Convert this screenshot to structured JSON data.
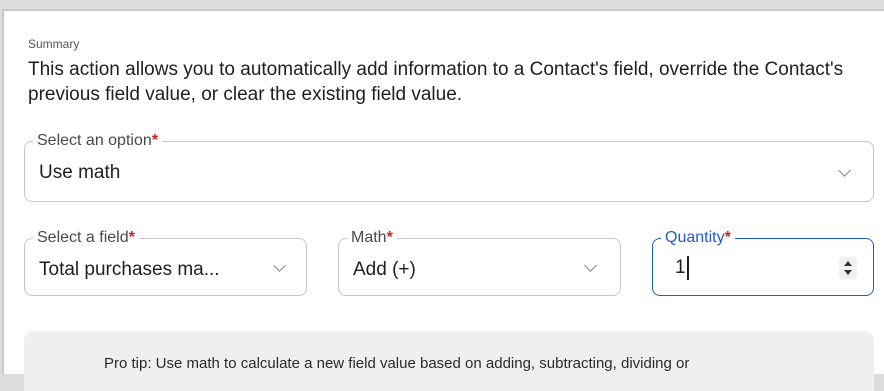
{
  "summary": {
    "label": "Summary",
    "text": "This action allows you to automatically add information to a Contact's field, override the Contact's previous field value, or clear the existing field value."
  },
  "option_select": {
    "label": "Select an option",
    "required_mark": "*",
    "value": "Use math",
    "icon": "chevron-down-icon"
  },
  "field_select": {
    "label": "Select a field",
    "required_mark": "*",
    "value": "Total purchases ma...",
    "icon": "chevron-down-icon"
  },
  "math_select": {
    "label": "Math",
    "required_mark": "*",
    "value": "Add (+)",
    "icon": "chevron-down-icon"
  },
  "quantity": {
    "label": "Quantity",
    "required_mark": "*",
    "value": "1",
    "focused": true,
    "accent_color": "#1f5cc8"
  },
  "pro_tip": {
    "text": "Pro tip: Use math to calculate a new field value based on adding, subtracting, dividing or"
  },
  "colors": {
    "required": "#d0201f",
    "focus": "#1f5cc8"
  }
}
